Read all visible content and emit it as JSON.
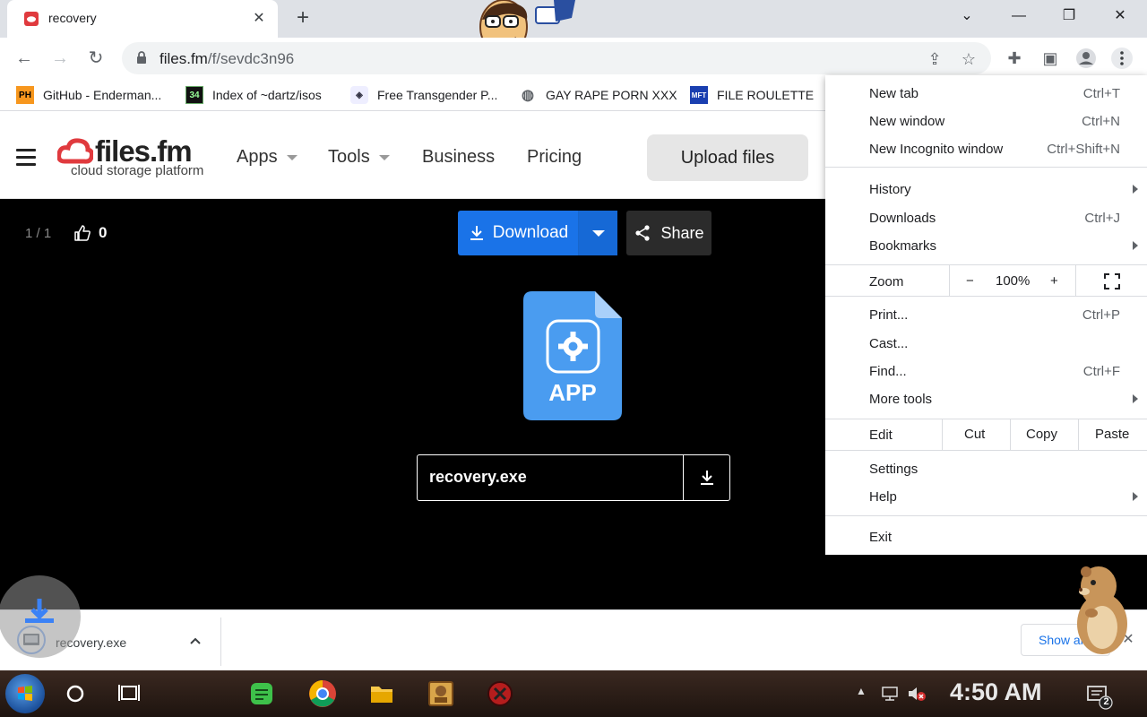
{
  "browser": {
    "tab_title": "recovery",
    "url_host": "files.fm",
    "url_path": "/f/sevdc3n96",
    "bookmarks": [
      {
        "icon": "PH",
        "label": "GitHub - Enderman..."
      },
      {
        "icon": "34",
        "label": "Index of ~dartz/isos"
      },
      {
        "icon": "globe",
        "label": "Free Transgender P..."
      },
      {
        "icon": "globe",
        "label": "GAY RAPE PORN XXX"
      },
      {
        "icon": "MFT",
        "label": "FILE ROULETTE"
      }
    ]
  },
  "site": {
    "logo_name": "files.fm",
    "logo_tagline": "cloud storage platform",
    "nav": {
      "apps": "Apps",
      "tools": "Tools",
      "business": "Business",
      "pricing": "Pricing"
    },
    "upload_label": "Upload files"
  },
  "viewer": {
    "counter": "1 / 1",
    "likes": "0",
    "download_label": "Download",
    "share_label": "Share",
    "file_type": "APP",
    "file_name": "recovery.exe"
  },
  "menu": {
    "new_tab": "New tab",
    "new_tab_sc": "Ctrl+T",
    "new_window": "New window",
    "new_window_sc": "Ctrl+N",
    "new_incognito": "New Incognito window",
    "new_incognito_sc": "Ctrl+Shift+N",
    "history": "History",
    "downloads": "Downloads",
    "downloads_sc": "Ctrl+J",
    "bookmarks": "Bookmarks",
    "zoom": "Zoom",
    "zoom_minus": "−",
    "zoom_value": "100%",
    "zoom_plus": "+",
    "print": "Print...",
    "print_sc": "Ctrl+P",
    "cast": "Cast...",
    "find": "Find...",
    "find_sc": "Ctrl+F",
    "more_tools": "More tools",
    "edit": "Edit",
    "cut": "Cut",
    "copy": "Copy",
    "paste": "Paste",
    "settings": "Settings",
    "help": "Help",
    "exit": "Exit"
  },
  "download_bar": {
    "file_name": "recovery.exe",
    "show_all": "Show all"
  },
  "taskbar": {
    "clock": "4:50 AM",
    "notification_count": "2"
  },
  "colors": {
    "accent": "#1a73e8",
    "brand_red": "#e03a3e",
    "file_icon_blue": "#4a9cf0"
  }
}
